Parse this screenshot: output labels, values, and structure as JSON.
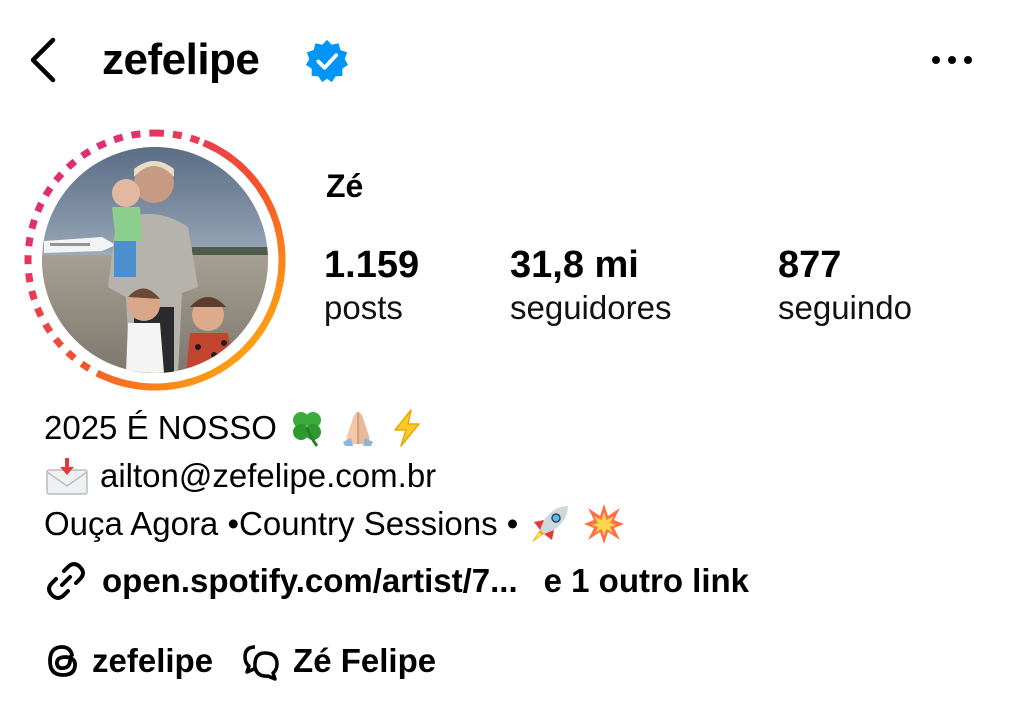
{
  "header": {
    "username": "zefelipe",
    "back_icon": "chevron-left-icon",
    "verified_icon": "verified-badge-icon",
    "more_icon": "more-horizontal-icon"
  },
  "profile": {
    "display_name": "Zé",
    "stats": [
      {
        "value": "1.159",
        "label": "posts"
      },
      {
        "value": "31,8 mi",
        "label": "seguidores"
      },
      {
        "value": "877",
        "label": "seguindo"
      }
    ]
  },
  "bio": {
    "line1": "2025 É NOSSO",
    "line1_emojis": [
      "four-leaf-clover-icon",
      "folded-hands-icon",
      "high-voltage-icon"
    ],
    "email_icon": "envelope-with-arrow-icon",
    "email": "ailton@zefelipe.com.br",
    "line3": "Ouça Agora •Country Sessions •",
    "line3_emojis": [
      "rocket-icon",
      "collision-icon"
    ]
  },
  "links": {
    "icon": "link-icon",
    "primary": "open.spotify.com/artist/7...",
    "more": "e 1 outro link"
  },
  "social": [
    {
      "icon": "threads-icon",
      "label": "zefelipe"
    },
    {
      "icon": "messenger-icon",
      "label": "Zé Felipe"
    }
  ],
  "colors": {
    "verified": "#0095F6",
    "ring_start": "#FFC107",
    "ring_mid": "#F5512B",
    "ring_end": "#E1306C",
    "text": "#000000"
  }
}
